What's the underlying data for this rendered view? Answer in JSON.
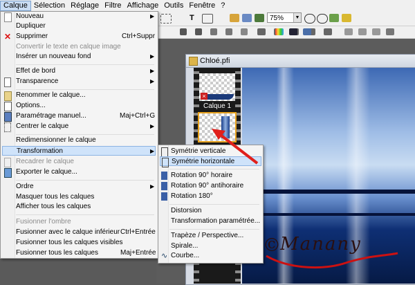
{
  "menubar": [
    "Calque",
    "Sélection",
    "Réglage",
    "Filtre",
    "Affichage",
    "Outils",
    "Fenêtre",
    "?"
  ],
  "toolbar": {
    "zoom_value": "75%"
  },
  "document": {
    "title": "Chloé.pfi",
    "layer_label": "Calque 1"
  },
  "main_menu": {
    "items": [
      {
        "label": "Nouveau",
        "arrow": true,
        "icon": "new-file-icon"
      },
      {
        "label": "Dupliquer"
      },
      {
        "label": "Supprimer",
        "shortcut": "Ctrl+Suppr",
        "icon": "delete-x-icon"
      },
      {
        "label": "Convertir le texte en calque image",
        "disabled": true
      },
      {
        "label": "Insérer un nouveau fond",
        "arrow": true
      },
      {
        "label": "Effet de bord",
        "arrow": true
      },
      {
        "label": "Transparence",
        "arrow": true,
        "icon": "transparency-icon"
      },
      {
        "label": "Renommer le calque...",
        "icon": "rename-icon"
      },
      {
        "label": "Options...",
        "icon": "options-icon"
      },
      {
        "label": "Paramétrage manuel...",
        "shortcut": "Maj+Ctrl+G",
        "icon": "manual-settings-icon"
      },
      {
        "label": "Centrer le calque",
        "arrow": true,
        "icon": "center-icon"
      },
      {
        "label": "Redimensionner le calque"
      },
      {
        "label": "Transformation",
        "arrow": true
      },
      {
        "label": "Recadrer le calque",
        "disabled": true,
        "icon": "crop-icon"
      },
      {
        "label": "Exporter le calque...",
        "icon": "export-icon"
      },
      {
        "label": "Ordre",
        "arrow": true
      },
      {
        "label": "Masquer tous les calques"
      },
      {
        "label": "Afficher tous les calques"
      },
      {
        "label": "Fusionner l'ombre",
        "disabled": true
      },
      {
        "label": "Fusionner avec le calque inférieur",
        "shortcut": "Ctrl+Entrée"
      },
      {
        "label": "Fusionner tous les calques visibles"
      },
      {
        "label": "Fusionner tous les calques",
        "shortcut": "Maj+Entrée"
      }
    ]
  },
  "sub_menu": {
    "items": [
      {
        "label": "Symétrie verticale",
        "icon": "flip-vertical-icon"
      },
      {
        "label": "Symétrie horizontale",
        "icon": "flip-horizontal-icon"
      },
      {
        "label": "Rotation 90° horaire",
        "icon": "rotate-cw-icon"
      },
      {
        "label": "Rotation 90° antihoraire",
        "icon": "rotate-ccw-icon"
      },
      {
        "label": "Rotation 180°",
        "icon": "rotate-180-icon"
      },
      {
        "label": "Distorsion"
      },
      {
        "label": "Transformation paramétrée..."
      },
      {
        "label": "Trapèze / Perspective..."
      },
      {
        "label": "Spirale..."
      },
      {
        "label": "Courbe...",
        "icon": "curve-icon"
      }
    ]
  },
  "watermark": {
    "copyright": "©",
    "name": "Manany"
  },
  "colors": {
    "highlight": "#cfe3fa",
    "arrow": "#e0201c",
    "selection_outline": "#e8a21d"
  }
}
